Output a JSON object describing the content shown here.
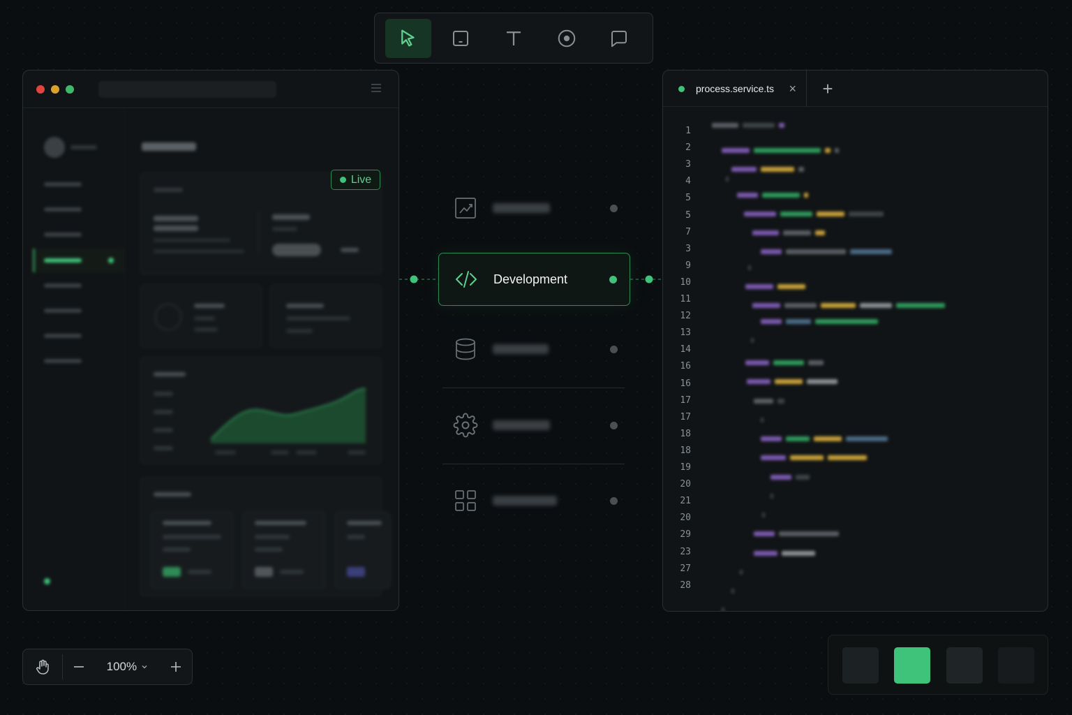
{
  "toolbar": {
    "tools": [
      {
        "icon": "cursor-icon",
        "active": true
      },
      {
        "icon": "frame-icon",
        "active": false
      },
      {
        "icon": "text-icon",
        "active": false
      },
      {
        "icon": "circle-icon",
        "active": false
      },
      {
        "icon": "comment-icon",
        "active": false
      }
    ]
  },
  "preview": {
    "status_badge": "Live"
  },
  "nodes": {
    "active_label": "Development",
    "items": [
      {
        "icon": "chart-icon",
        "active": false
      },
      {
        "icon": "code-icon",
        "active": true
      },
      {
        "icon": "database-icon",
        "active": false
      },
      {
        "icon": "gear-icon",
        "active": false
      },
      {
        "icon": "grid-icon",
        "active": false
      }
    ]
  },
  "editor": {
    "tab_name": "process.service.ts",
    "tab_close": "×",
    "tab_add": "+",
    "line_numbers": [
      "1",
      "2",
      "3",
      "4",
      "5",
      "5",
      "7",
      "3",
      "9",
      "10",
      "11",
      "12",
      "13",
      "14",
      "16",
      "16",
      "17",
      "17",
      "18",
      "18",
      "19",
      "20",
      "21",
      "20",
      "29",
      "23",
      "27",
      "28"
    ]
  },
  "zoom": {
    "level": "100%"
  },
  "colors": {
    "accent": "#3fc27a",
    "background": "#0b0e10",
    "panel": "#111416"
  }
}
